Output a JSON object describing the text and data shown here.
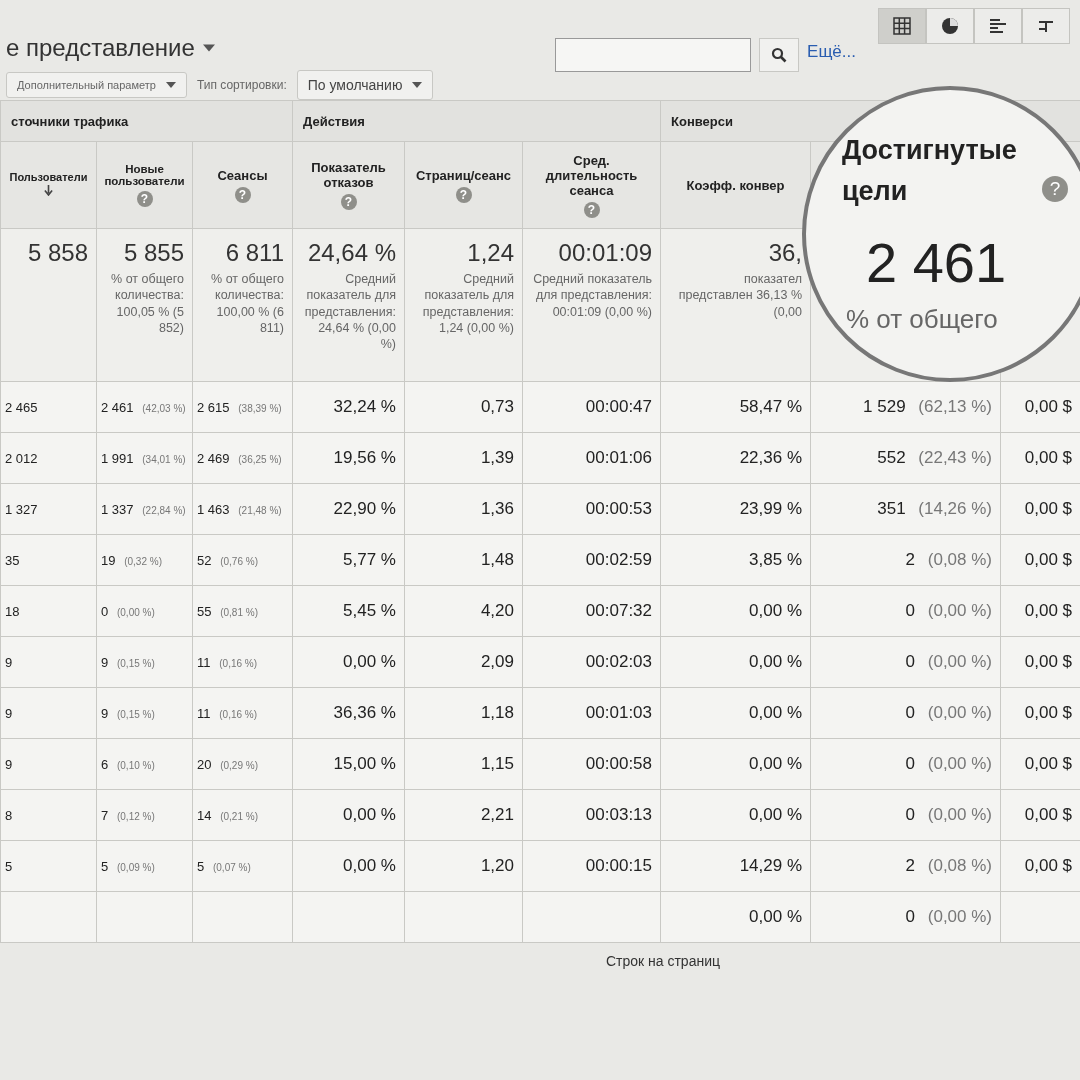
{
  "view_title": "е представление",
  "toolbar": {
    "secondary_dimension": "Дополнительный параметр",
    "sort_label": "Тип сортировки:",
    "sort_value": "По умолчанию",
    "more_link": "Ещё...",
    "view_buttons": [
      {
        "kind": "table",
        "selected": true
      },
      {
        "kind": "pie",
        "selected": false
      },
      {
        "kind": "bars",
        "selected": false
      },
      {
        "kind": "pivot",
        "selected": false
      }
    ]
  },
  "table": {
    "groups": [
      {
        "label": "сточники трафика"
      },
      {
        "label": "Действия"
      },
      {
        "label": "Конверси"
      }
    ],
    "columns": [
      {
        "label": "Пользователи",
        "sorted": true
      },
      {
        "label": "Новые пользователи",
        "help": "?"
      },
      {
        "label": "Сеансы",
        "help": "?"
      },
      {
        "label": "Показатель отказов",
        "help": "?"
      },
      {
        "label": "Страниц/сеанс",
        "help": "?"
      },
      {
        "label": "Сред. длительность сеанса",
        "help": "?"
      },
      {
        "label": "Коэфф. конвер"
      }
    ],
    "totals": [
      {
        "value": "5 858"
      },
      {
        "value": "5 855",
        "note": "% от общего количества: 100,05 % (5 852)"
      },
      {
        "value": "6 811",
        "note": "% от общего количества: 100,00 % (6 811)"
      },
      {
        "value": "24,64 %",
        "note": "Средний показатель для представления: 24,64 % (0,00 %)"
      },
      {
        "value": "1,24",
        "note": "Средний показатель для представления: 1,24 (0,00 %)"
      },
      {
        "value": "00:01:09",
        "note": "Средний показатель для представления: 00:01:09 (0,00 %)"
      },
      {
        "value": "36,",
        "note": "показател представлен 36,13 % (0,00"
      }
    ],
    "rows": [
      {
        "cells": [
          {
            "v": "2 465"
          },
          {
            "v": "2 461",
            "p": "(42,03 %)"
          },
          {
            "v": "2 615",
            "p": "(38,39 %)"
          },
          {
            "v": "32,24 %"
          },
          {
            "v": "0,73"
          },
          {
            "v": "00:00:47"
          },
          {
            "v": "58,47 %"
          },
          {
            "v": "1 529",
            "p": "(62,13 %)"
          },
          {
            "v": "0,00 $"
          }
        ]
      },
      {
        "cells": [
          {
            "v": "2 012"
          },
          {
            "v": "1 991",
            "p": "(34,01 %)"
          },
          {
            "v": "2 469",
            "p": "(36,25 %)"
          },
          {
            "v": "19,56 %"
          },
          {
            "v": "1,39"
          },
          {
            "v": "00:01:06"
          },
          {
            "v": "22,36 %"
          },
          {
            "v": "552",
            "p": "(22,43 %)"
          },
          {
            "v": "0,00 $"
          }
        ]
      },
      {
        "cells": [
          {
            "v": "1 327"
          },
          {
            "v": "1 337",
            "p": "(22,84 %)"
          },
          {
            "v": "1 463",
            "p": "(21,48 %)"
          },
          {
            "v": "22,90 %"
          },
          {
            "v": "1,36"
          },
          {
            "v": "00:00:53"
          },
          {
            "v": "23,99 %"
          },
          {
            "v": "351",
            "p": "(14,26 %)"
          },
          {
            "v": "0,00 $"
          }
        ]
      },
      {
        "cells": [
          {
            "v": "35"
          },
          {
            "v": "19",
            "p": "(0,32 %)"
          },
          {
            "v": "52",
            "p": "(0,76 %)"
          },
          {
            "v": "5,77 %"
          },
          {
            "v": "1,48"
          },
          {
            "v": "00:02:59"
          },
          {
            "v": "3,85 %"
          },
          {
            "v": "2",
            "p": "(0,08 %)"
          },
          {
            "v": "0,00 $"
          }
        ]
      },
      {
        "cells": [
          {
            "v": "18"
          },
          {
            "v": "0",
            "p": "(0,00 %)"
          },
          {
            "v": "55",
            "p": "(0,81 %)"
          },
          {
            "v": "5,45 %"
          },
          {
            "v": "4,20"
          },
          {
            "v": "00:07:32"
          },
          {
            "v": "0,00 %"
          },
          {
            "v": "0",
            "p": "(0,00 %)"
          },
          {
            "v": "0,00 $"
          }
        ]
      },
      {
        "cells": [
          {
            "v": "9"
          },
          {
            "v": "9",
            "p": "(0,15 %)"
          },
          {
            "v": "11",
            "p": "(0,16 %)"
          },
          {
            "v": "0,00 %"
          },
          {
            "v": "2,09"
          },
          {
            "v": "00:02:03"
          },
          {
            "v": "0,00 %"
          },
          {
            "v": "0",
            "p": "(0,00 %)"
          },
          {
            "v": "0,00 $"
          }
        ]
      },
      {
        "cells": [
          {
            "v": "9"
          },
          {
            "v": "9",
            "p": "(0,15 %)"
          },
          {
            "v": "11",
            "p": "(0,16 %)"
          },
          {
            "v": "36,36 %"
          },
          {
            "v": "1,18"
          },
          {
            "v": "00:01:03"
          },
          {
            "v": "0,00 %"
          },
          {
            "v": "0",
            "p": "(0,00 %)"
          },
          {
            "v": "0,00 $"
          }
        ]
      },
      {
        "cells": [
          {
            "v": "9"
          },
          {
            "v": "6",
            "p": "(0,10 %)"
          },
          {
            "v": "20",
            "p": "(0,29 %)"
          },
          {
            "v": "15,00 %"
          },
          {
            "v": "1,15"
          },
          {
            "v": "00:00:58"
          },
          {
            "v": "0,00 %"
          },
          {
            "v": "0",
            "p": "(0,00 %)"
          },
          {
            "v": "0,00 $"
          }
        ]
      },
      {
        "cells": [
          {
            "v": "8"
          },
          {
            "v": "7",
            "p": "(0,12 %)"
          },
          {
            "v": "14",
            "p": "(0,21 %)"
          },
          {
            "v": "0,00 %"
          },
          {
            "v": "2,21"
          },
          {
            "v": "00:03:13"
          },
          {
            "v": "0,00 %"
          },
          {
            "v": "0",
            "p": "(0,00 %)"
          },
          {
            "v": "0,00 $"
          }
        ]
      },
      {
        "cells": [
          {
            "v": "5"
          },
          {
            "v": "5",
            "p": "(0,09 %)"
          },
          {
            "v": "5",
            "p": "(0,07 %)"
          },
          {
            "v": "0,00 %"
          },
          {
            "v": "1,20"
          },
          {
            "v": "00:00:15"
          },
          {
            "v": "14,29 %"
          },
          {
            "v": "2",
            "p": "(0,08 %)"
          },
          {
            "v": "0,00 $"
          }
        ]
      },
      {
        "cells": [
          null,
          null,
          null,
          null,
          null,
          null,
          {
            "v": "0,00 %"
          },
          {
            "v": "0",
            "p": "(0,00 %)"
          },
          null
        ]
      }
    ]
  },
  "footer": {
    "rows_per_page": "Строк на страниц"
  },
  "magnifier": {
    "heading": "Достигнутые цели",
    "help": "?",
    "value": "2 461",
    "note": "% от общего"
  }
}
